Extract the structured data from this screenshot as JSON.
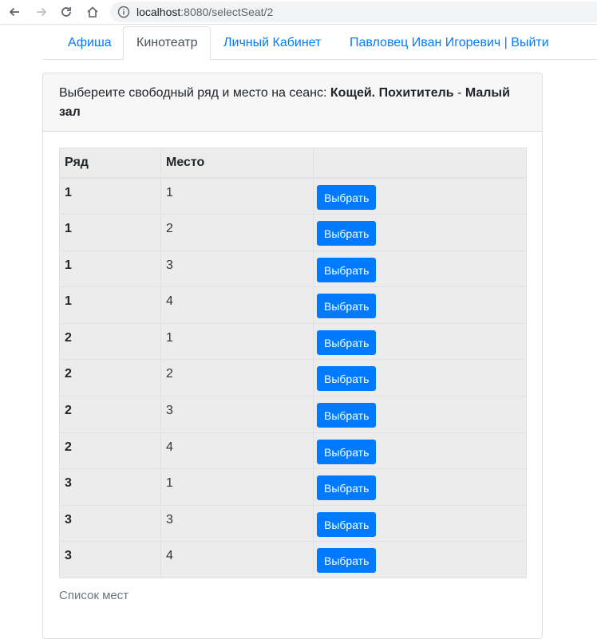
{
  "browser": {
    "url_host": "localhost",
    "url_rest": ":8080/selectSeat/2"
  },
  "nav": {
    "tabs": [
      {
        "label": "Афиша"
      },
      {
        "label": "Кинотеатр"
      },
      {
        "label": "Личный Кабинет"
      },
      {
        "label": "Павловец Иван Игоревич | Выйти"
      }
    ]
  },
  "card": {
    "prompt": "Выбереите свободный ряд и место на сеанс: ",
    "movie": "Кощей. Похититель",
    "separator": " - ",
    "hall": "Малый зал"
  },
  "table": {
    "headers": [
      "Ряд",
      "Место",
      ""
    ],
    "button_label": "Выбрать",
    "rows": [
      {
        "row": "1",
        "seat": "1"
      },
      {
        "row": "1",
        "seat": "2"
      },
      {
        "row": "1",
        "seat": "3"
      },
      {
        "row": "1",
        "seat": "4"
      },
      {
        "row": "2",
        "seat": "1"
      },
      {
        "row": "2",
        "seat": "2"
      },
      {
        "row": "2",
        "seat": "3"
      },
      {
        "row": "2",
        "seat": "4"
      },
      {
        "row": "3",
        "seat": "1"
      },
      {
        "row": "3",
        "seat": "3"
      },
      {
        "row": "3",
        "seat": "4"
      }
    ],
    "caption": "Список мест"
  },
  "colors": {
    "primary": "#007bff",
    "table_bg": "#ececec"
  }
}
